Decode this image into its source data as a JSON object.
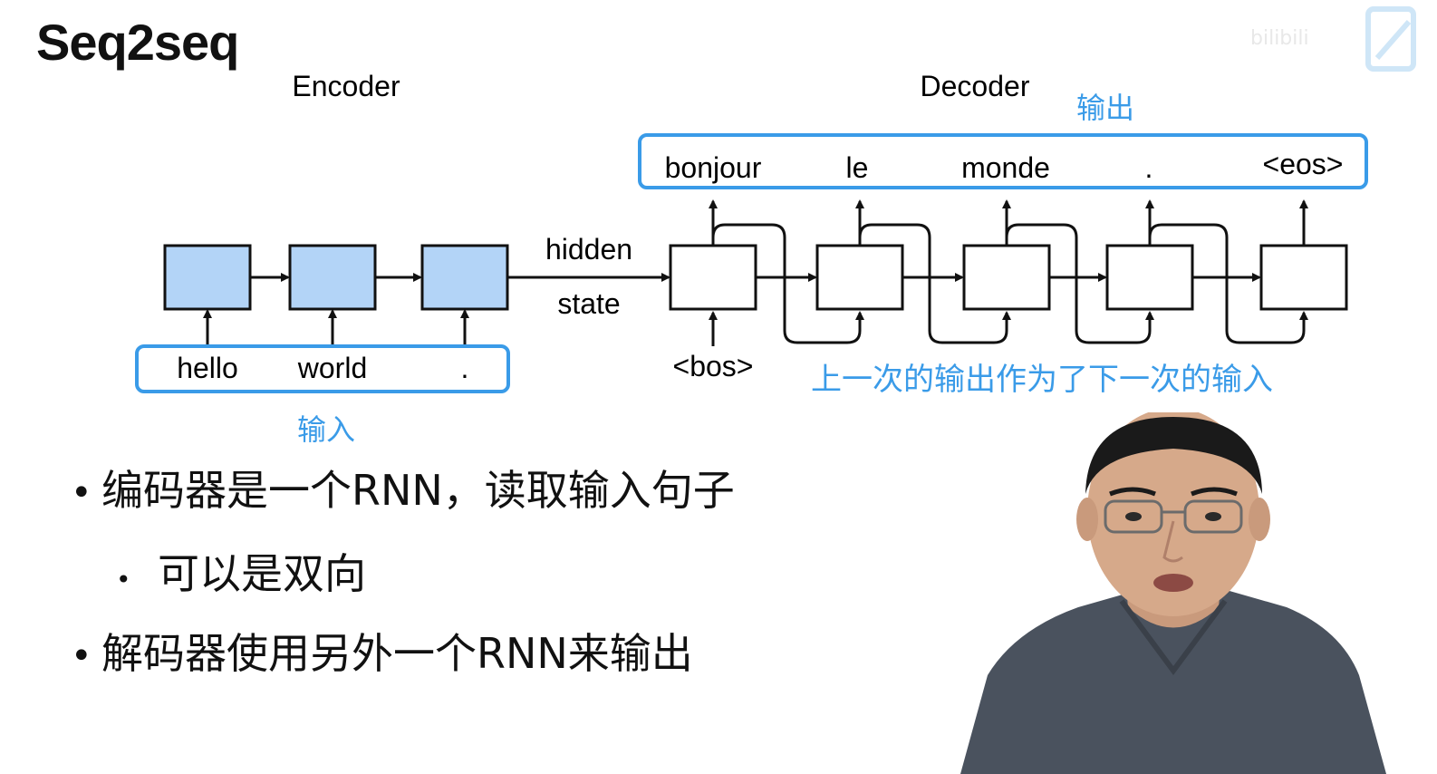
{
  "title": "Seq2seq",
  "diagram": {
    "encoder_label": "Encoder",
    "decoder_label": "Decoder",
    "hidden_label": "hidden",
    "state_label": "state",
    "input_tokens": [
      "hello",
      "world",
      "."
    ],
    "decoder_start": "<bos>",
    "output_tokens": [
      "bonjour",
      "le",
      "monde",
      ".",
      "<eos>"
    ],
    "annotation_output": "输出",
    "annotation_input": "输入",
    "annotation_feedback": "上一次的输出作为了下一次的输入",
    "annotation_color": "#3a9be8",
    "encoder_fill": "#b3d4f7"
  },
  "bullets": {
    "item1": "编码器是一个RNN，读取输入句子",
    "item1_sub": "可以是双向",
    "item2": "解码器使用另外一个RNN来输出"
  }
}
